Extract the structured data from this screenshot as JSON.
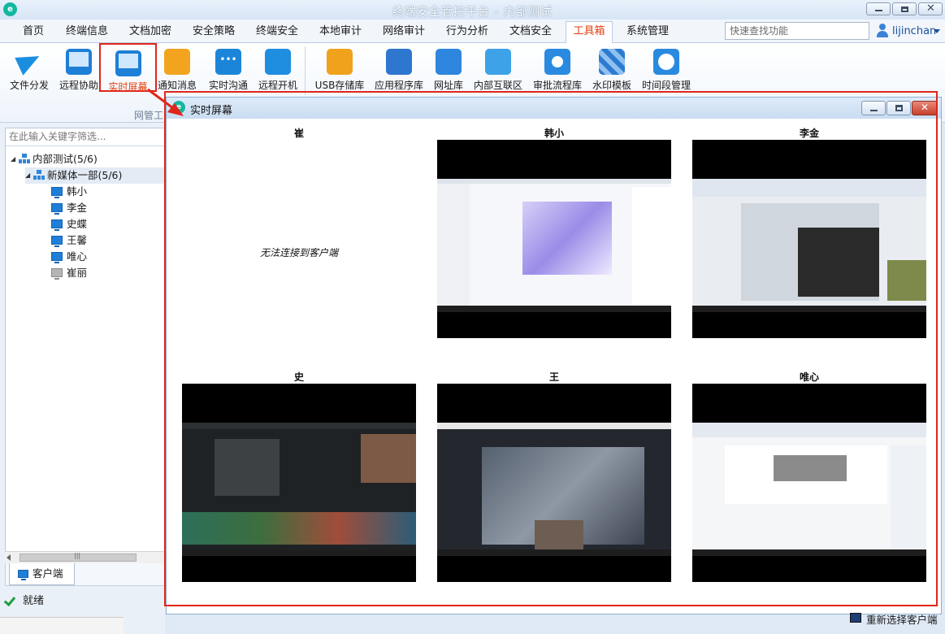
{
  "app": {
    "title": "终端安全管控平台 - 内部测试",
    "logo_text": "e"
  },
  "menu": {
    "items": [
      "首页",
      "终端信息",
      "文档加密",
      "安全策略",
      "终端安全",
      "本地审计",
      "网络审计",
      "行为分析",
      "文档安全",
      "工具箱",
      "系统管理"
    ],
    "active_index": 9,
    "search_placeholder": "快速查找功能",
    "user": "lijinchan"
  },
  "toolbar": {
    "tools": [
      {
        "label": "文件分发",
        "icon": "paper-plane-icon"
      },
      {
        "label": "远程协助",
        "icon": "monitor-search-icon"
      },
      {
        "label": "实时屏幕",
        "icon": "monitor-picture-icon"
      },
      {
        "label": "通知消息",
        "icon": "bell-icon"
      },
      {
        "label": "实时沟通",
        "icon": "chat-bubble-icon"
      },
      {
        "label": "远程开机",
        "icon": "remote-power-icon"
      },
      {
        "label": "USB存储库",
        "icon": "usb-icon"
      },
      {
        "label": "应用程序库",
        "icon": "tools-icon"
      },
      {
        "label": "网址库",
        "icon": "globe-icon"
      },
      {
        "label": "内部互联区",
        "icon": "sync-icon"
      },
      {
        "label": "审批流程库",
        "icon": "gear-user-icon"
      },
      {
        "label": "水印模板",
        "icon": "mosaic-icon"
      },
      {
        "label": "时间段管理",
        "icon": "clock-icon"
      }
    ],
    "group_label": "网管工"
  },
  "tree": {
    "filter_placeholder": "在此输入关键字筛选...",
    "root": "内部测试(5/6)",
    "group": "新媒体一部(5/6)",
    "clients": [
      {
        "name": "韩小",
        "online": true
      },
      {
        "name": "李金",
        "online": true
      },
      {
        "name": "史蝶",
        "online": true
      },
      {
        "name": "王馨",
        "online": true
      },
      {
        "name": "唯心",
        "online": true
      },
      {
        "name": "崔丽",
        "online": false
      }
    ]
  },
  "client_tab": "客户端",
  "status": "就绪",
  "realtime": {
    "title": "实时屏幕",
    "screens": [
      {
        "name": "崔",
        "offline": true,
        "message": "无法连接到客户端"
      },
      {
        "name": "韩小",
        "offline": false
      },
      {
        "name": "李金",
        "offline": false
      },
      {
        "name": "史",
        "offline": false
      },
      {
        "name": "王",
        "offline": false
      },
      {
        "name": "唯心",
        "offline": false
      }
    ],
    "reselect_label": "重新选择客户端"
  },
  "colors": {
    "accent": "#e4400e",
    "highlight": "#e0261b",
    "brand": "#14b7a0"
  }
}
